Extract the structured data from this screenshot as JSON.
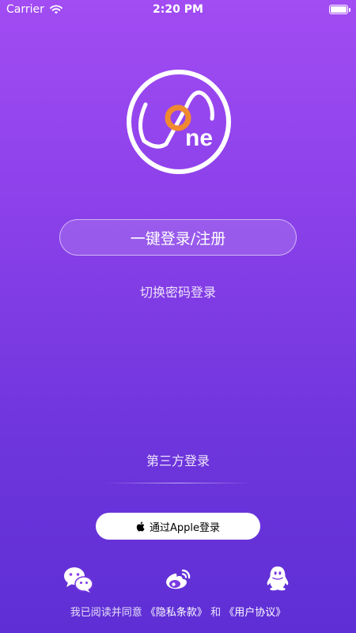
{
  "status_bar": {
    "carrier": "Carrier",
    "time": "2:20 PM",
    "battery_level": 1.0
  },
  "logo": {
    "text": "ne"
  },
  "login": {
    "one_click_label": "一键登录/注册",
    "switch_password_label": "切换密码登录"
  },
  "third_party": {
    "title": "第三方登录",
    "apple_label": "通过Apple登录",
    "icons": [
      "wechat-icon",
      "weibo-icon",
      "qq-icon"
    ]
  },
  "agreement": {
    "prefix": "我已阅读并同意",
    "privacy": "《隐私条款》",
    "and": " 和 ",
    "terms": "《用户协议》"
  },
  "colors": {
    "background_top": "#A24CF3",
    "background_bottom": "#5E2FD5",
    "logo_accent": "#F08A30"
  }
}
